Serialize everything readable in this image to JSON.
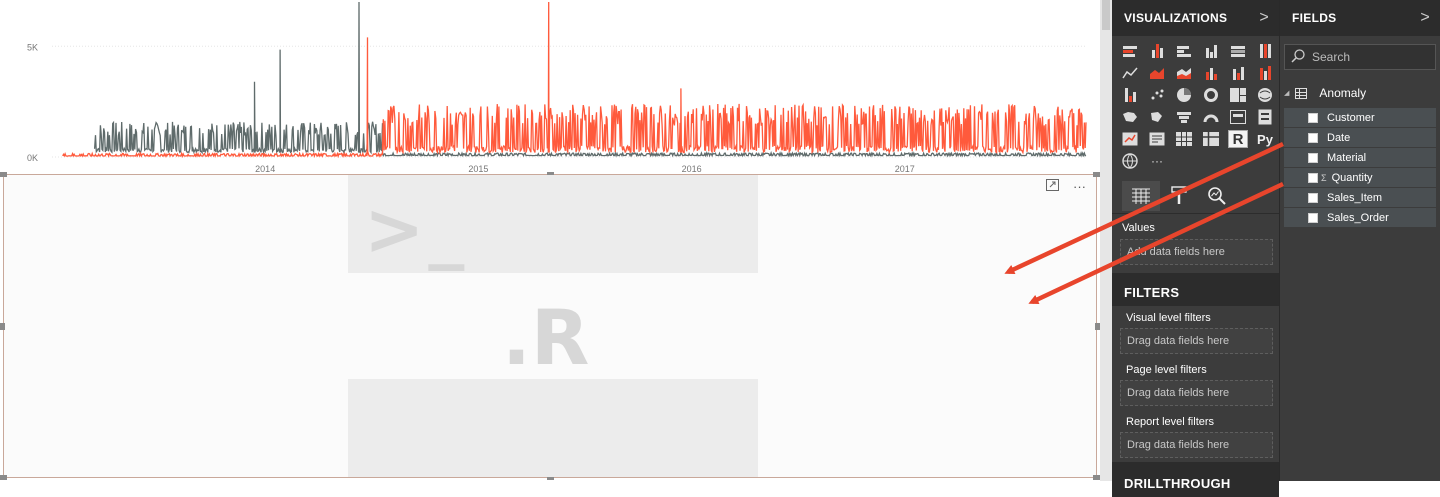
{
  "chart_data": {
    "type": "line",
    "y_ticks": [
      "5K",
      "0K"
    ],
    "x_ticks": [
      "2014",
      "2015",
      "2016",
      "2017"
    ],
    "xlim": [
      2013.0,
      2017.85
    ],
    "ylim": [
      0,
      7000
    ],
    "grid": true,
    "series": [
      {
        "color": "#5f6b6b",
        "segments": [
          {
            "range": [
              2013.2,
              2014.55
            ],
            "base": 200,
            "amp": 1400
          },
          {
            "range": [
              2014.55,
              2017.85
            ],
            "base": 60,
            "amp": 120
          }
        ],
        "spikes": [
          [
            2013.95,
            3400
          ],
          [
            2014.07,
            4850
          ],
          [
            2014.44,
            7000
          ]
        ]
      },
      {
        "color": "#ff5a3c",
        "segments": [
          {
            "range": [
              2013.05,
              2014.55
            ],
            "base": 40,
            "amp": 120
          },
          {
            "range": [
              2014.55,
              2017.85
            ],
            "base": 200,
            "amp": 2200
          }
        ],
        "spikes": [
          [
            2014.48,
            5400
          ],
          [
            2015.33,
            7000
          ],
          [
            2015.95,
            3100
          ]
        ]
      }
    ]
  },
  "r_visual": {
    "prompt_text": ">_",
    "logo_text": ".R",
    "expand_icon": "expand-icon",
    "more_icon": "more-options-icon",
    "more_label": "···"
  },
  "visualizations": {
    "title": "VISUALIZATIONS",
    "chevron": ">",
    "r_icon_label": "R",
    "py_icon_label": "Py",
    "more_label": "···",
    "values_label": "Values",
    "values_placeholder": "Add data fields here",
    "tools": [
      "fields-icon",
      "format-paint-icon",
      "analytics-icon"
    ]
  },
  "filters": {
    "title": "FILTERS",
    "visual_label": "Visual level filters",
    "visual_placeholder": "Drag data fields here",
    "page_label": "Page level filters",
    "page_placeholder": "Drag data fields here",
    "report_label": "Report level filters",
    "report_placeholder": "Drag data fields here"
  },
  "drillthrough": {
    "title": "DRILLTHROUGH"
  },
  "fields": {
    "title": "FIELDS",
    "chevron": ">",
    "search_placeholder": "Search",
    "table_name": "Anomaly",
    "items": [
      {
        "label": "Customer",
        "sigma": false
      },
      {
        "label": "Date",
        "sigma": false
      },
      {
        "label": "Material",
        "sigma": false
      },
      {
        "label": "Quantity",
        "sigma": true
      },
      {
        "label": "Sales_Item",
        "sigma": false
      },
      {
        "label": "Sales_Order",
        "sigma": false
      }
    ]
  },
  "colors": {
    "arrow": "#e8452c",
    "pane_bg": "#3c3c3c",
    "header_bg": "#2c2c2c"
  }
}
